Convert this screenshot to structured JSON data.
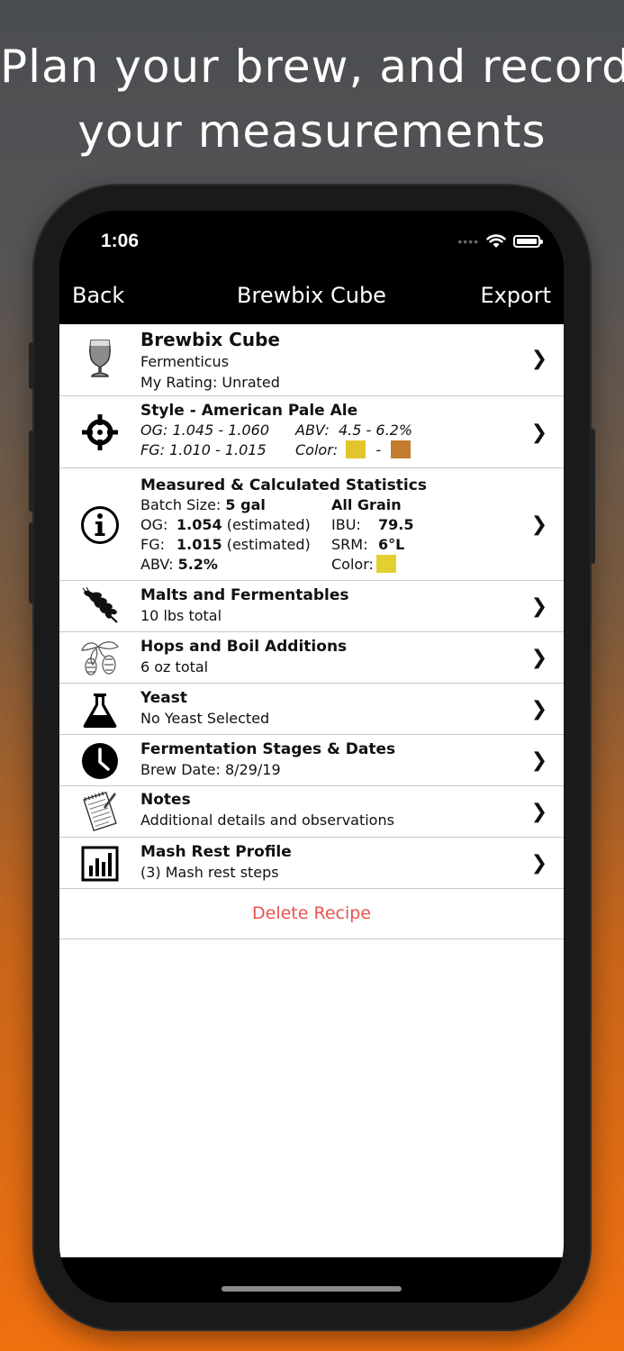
{
  "headline": {
    "line1": "Plan your brew, and record",
    "line2": "your measurements"
  },
  "status_bar": {
    "time": "1:06"
  },
  "nav": {
    "back": "Back",
    "title": "Brewbix Cube",
    "export": "Export"
  },
  "recipe": {
    "name": "Brewbix Cube",
    "brewer": "Fermenticus",
    "rating": "My Rating:  Unrated"
  },
  "style": {
    "title": "Style - American Pale Ale",
    "og_label": "OG:",
    "og": "1.045 - 1.060",
    "abv_label": "ABV:",
    "abv": "4.5 - 6.2%",
    "fg_label": "FG:",
    "fg": "1.010 - 1.015",
    "color_label": "Color:",
    "color_sep": "-",
    "color_low": "#e2c52c",
    "color_high": "#c47c2e"
  },
  "stats": {
    "title": "Measured & Calculated Statistics",
    "batch_label": "Batch Size:",
    "batch_value": "5 gal",
    "grain": "All Grain",
    "og_label": "OG:",
    "og_value": "1.054",
    "og_note": "(estimated)",
    "ibu_label": "IBU:",
    "ibu_value": "79.5",
    "fg_label": "FG:",
    "fg_value": "1.015",
    "fg_note": "(estimated)",
    "srm_label": "SRM:",
    "srm_value": "6°L",
    "abv_label": "ABV:",
    "abv_value": "5.2%",
    "color_label": "Color:",
    "color": "#e2d030"
  },
  "sections": [
    {
      "title": "Malts and Fermentables",
      "subtitle": "10 lbs total",
      "icon": "wheat-icon"
    },
    {
      "title": "Hops and Boil Additions",
      "subtitle": "6 oz total",
      "icon": "hops-icon"
    },
    {
      "title": "Yeast",
      "subtitle": "No Yeast Selected",
      "icon": "flask-icon"
    },
    {
      "title": "Fermentation Stages & Dates",
      "subtitle": "Brew Date: 8/29/19",
      "icon": "clock-icon"
    },
    {
      "title": "Notes",
      "subtitle": "Additional details and observations",
      "icon": "notepad-icon"
    },
    {
      "title": "Mash Rest Profile",
      "subtitle": "(3) Mash rest steps",
      "icon": "bar-chart-icon"
    }
  ],
  "delete_label": "Delete Recipe"
}
